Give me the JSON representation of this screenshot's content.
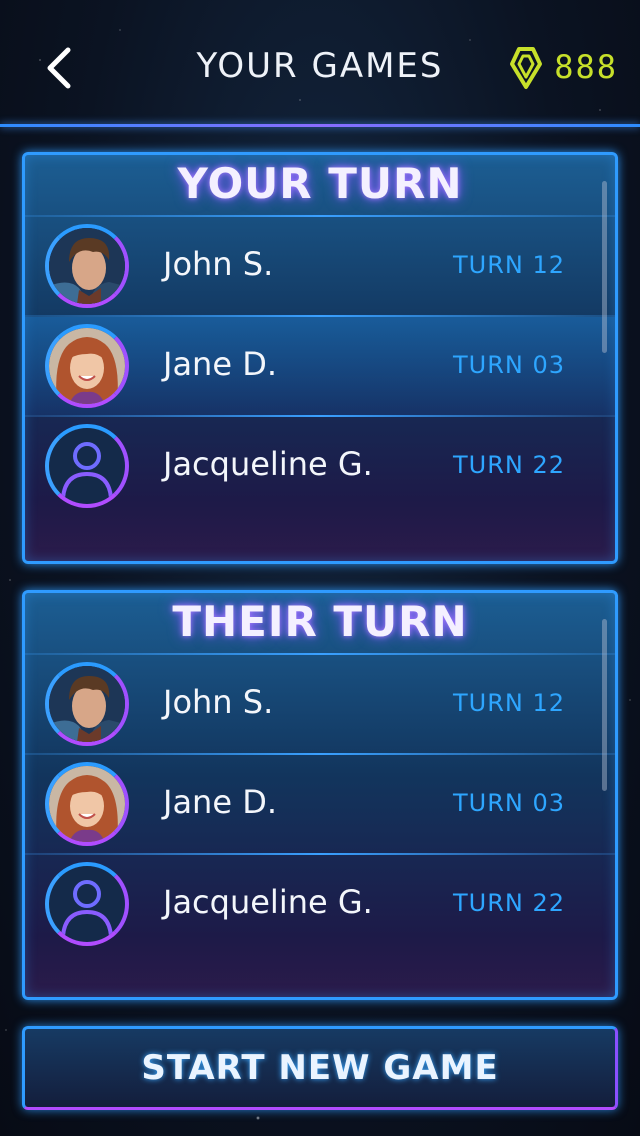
{
  "header": {
    "title": "YOUR GAMES",
    "gem_count": "888",
    "gem_color": "#c7e02a"
  },
  "your_turn": {
    "title": "YOUR TURN",
    "games": [
      {
        "name": "John S.",
        "turn": "TURN 12",
        "avatar": "photo-man"
      },
      {
        "name": "Jane D.",
        "turn": "TURN 03",
        "avatar": "photo-woman",
        "selected": true
      },
      {
        "name": "Jacqueline G.",
        "turn": "TURN 22",
        "avatar": "placeholder-person-icon"
      }
    ]
  },
  "their_turn": {
    "title": "THEIR TURN",
    "games": [
      {
        "name": "John S.",
        "turn": "TURN 12",
        "avatar": "photo-man"
      },
      {
        "name": "Jane D.",
        "turn": "TURN 03",
        "avatar": "photo-woman"
      },
      {
        "name": "Jacqueline G.",
        "turn": "TURN 22",
        "avatar": "placeholder-person-icon"
      }
    ]
  },
  "start_button": {
    "label": "START NEW GAME"
  },
  "colors": {
    "accent_blue": "#2f9bff",
    "accent_purple": "#a050ff",
    "turn_text": "#2ea6ff"
  }
}
